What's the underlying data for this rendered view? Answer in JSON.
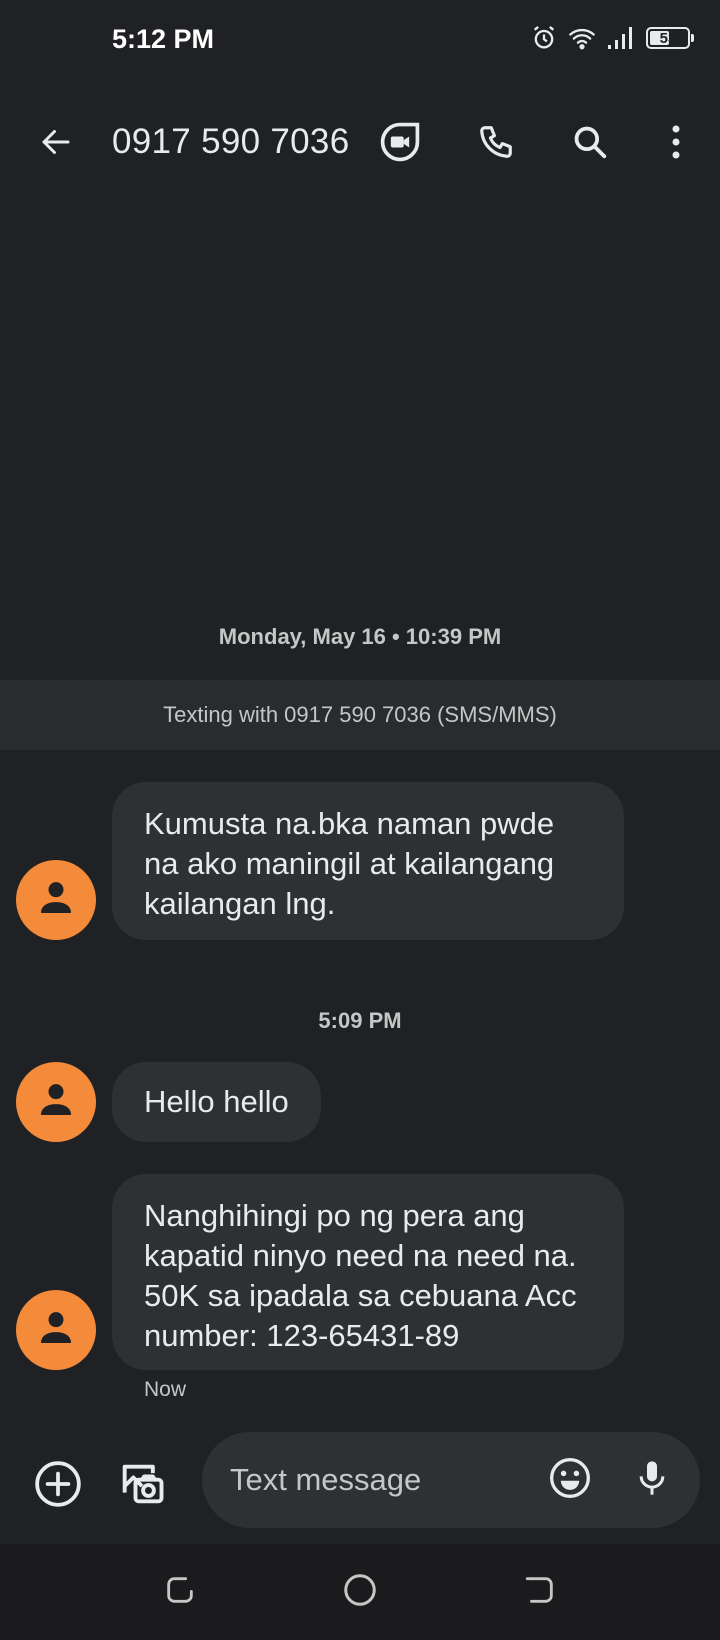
{
  "status_bar": {
    "time": "5:12 PM",
    "battery": "53",
    "battery_level": 0.53,
    "icons": [
      "alarm-icon",
      "wifi-icon",
      "signal-icon",
      "battery-icon"
    ]
  },
  "app_bar": {
    "title": "0917 590 7036",
    "icons": [
      "back-arrow-icon",
      "video-call-icon",
      "phone-icon",
      "search-icon",
      "more-vert-icon"
    ]
  },
  "conversation": {
    "date_header": "Monday, May 16 • 10:39 PM",
    "info_banner": "Texting with 0917 590 7036 (SMS/MMS)",
    "messages": [
      {
        "text": "Kumusta na.bka naman pwde na ako maningil at kailangang kailangan lng."
      },
      {
        "text": "Hello hello"
      },
      {
        "text": "Nanghihingi po ng pera ang kapatid ninyo need na need na. 50K sa ipadala sa cebuana Acc number: 123-65431-89"
      }
    ],
    "time_separator": "5:09 PM",
    "last_message_time": "Now"
  },
  "compose": {
    "placeholder": "Text message",
    "value": "",
    "icons": [
      "add-icon",
      "gallery-icon",
      "emoji-icon",
      "mic-icon"
    ]
  },
  "colors": {
    "background": "#202124",
    "bubble": "#2f3034",
    "avatar": "#f38b3a",
    "text": "#e8eaed",
    "secondary_text": "#c4c7c5"
  }
}
